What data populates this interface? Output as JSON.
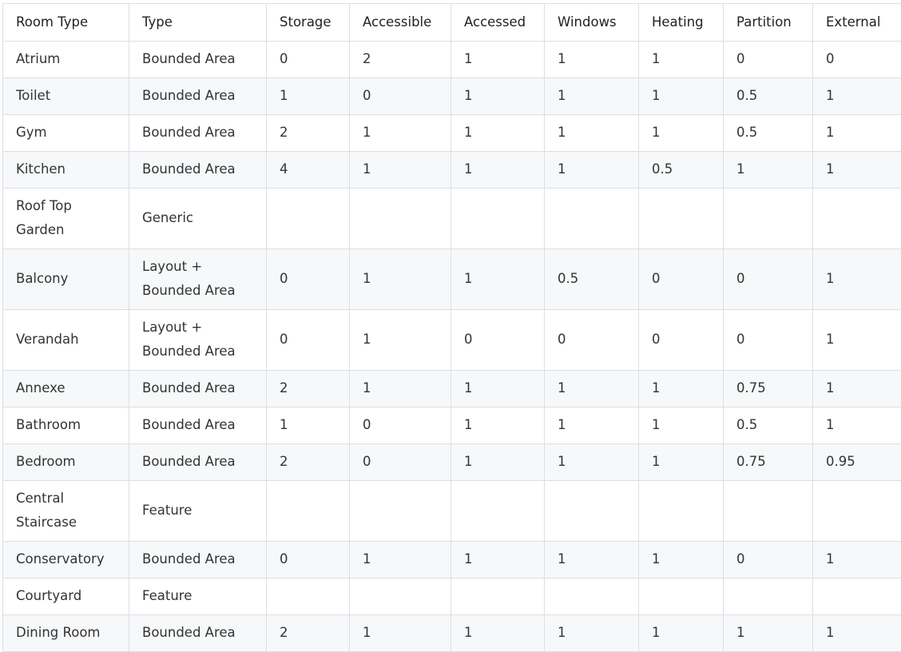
{
  "table": {
    "headers": [
      "Room Type",
      "Type",
      "Storage",
      "Accessible",
      "Accessed",
      "Windows",
      "Heating",
      "Partition",
      "External"
    ],
    "rows": [
      [
        "Atrium",
        "Bounded Area",
        "0",
        "2",
        "1",
        "1",
        "1",
        "0",
        "0"
      ],
      [
        "Toilet",
        "Bounded Area",
        "1",
        "0",
        "1",
        "1",
        "1",
        "0.5",
        "1"
      ],
      [
        "Gym",
        "Bounded Area",
        "2",
        "1",
        "1",
        "1",
        "1",
        "0.5",
        "1"
      ],
      [
        "Kitchen",
        "Bounded Area",
        "4",
        "1",
        "1",
        "1",
        "0.5",
        "1",
        "1"
      ],
      [
        "Roof Top Garden",
        "Generic",
        "",
        "",
        "",
        "",
        "",
        "",
        ""
      ],
      [
        "Balcony",
        "Layout + Bounded Area",
        "0",
        "1",
        "1",
        "0.5",
        "0",
        "0",
        "1"
      ],
      [
        "Verandah",
        "Layout + Bounded Area",
        "0",
        "1",
        "0",
        "0",
        "0",
        "0",
        "1"
      ],
      [
        "Annexe",
        "Bounded Area",
        "2",
        "1",
        "1",
        "1",
        "1",
        "0.75",
        "1"
      ],
      [
        "Bathroom",
        "Bounded Area",
        "1",
        "0",
        "1",
        "1",
        "1",
        "0.5",
        "1"
      ],
      [
        "Bedroom",
        "Bounded Area",
        "2",
        "0",
        "1",
        "1",
        "1",
        "0.75",
        "0.95"
      ],
      [
        "Central Staircase",
        "Feature",
        "",
        "",
        "",
        "",
        "",
        "",
        ""
      ],
      [
        "Conservatory",
        "Bounded Area",
        "0",
        "1",
        "1",
        "1",
        "1",
        "0",
        "1"
      ],
      [
        "Courtyard",
        "Feature",
        "",
        "",
        "",
        "",
        "",
        "",
        ""
      ],
      [
        "Dining Room",
        "Bounded Area",
        "2",
        "1",
        "1",
        "1",
        "1",
        "1",
        "1"
      ]
    ]
  }
}
